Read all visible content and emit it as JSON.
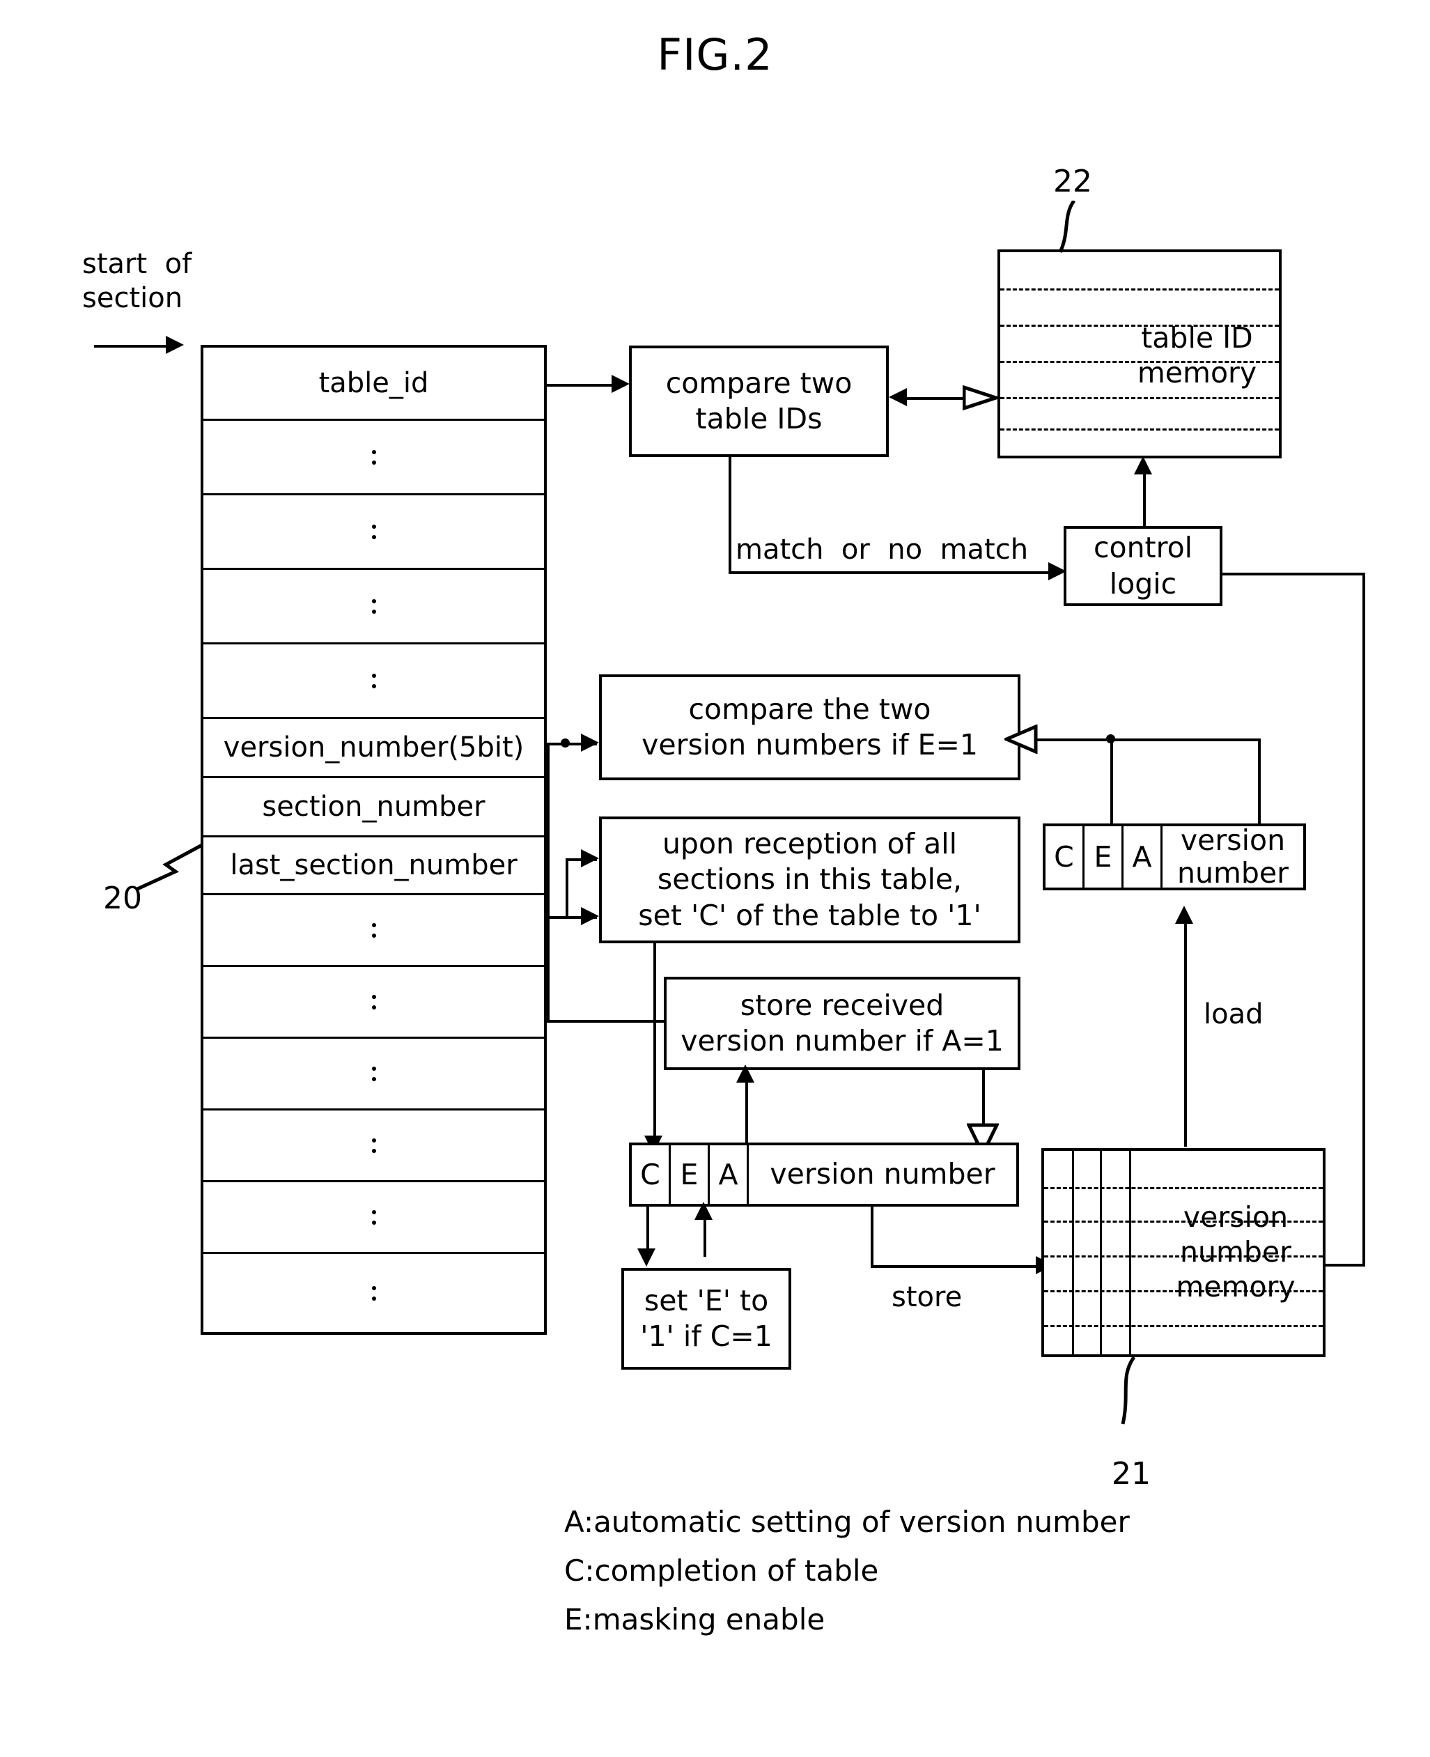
{
  "figure": {
    "title": "FIG.2"
  },
  "input": {
    "start_label": "start  of\nsection"
  },
  "section_table": {
    "ref": "20",
    "rows": [
      {
        "label": "table_id",
        "type": "text"
      },
      {
        "label": "",
        "type": "dots"
      },
      {
        "label": "",
        "type": "dots"
      },
      {
        "label": "",
        "type": "dots"
      },
      {
        "label": "",
        "type": "dots"
      },
      {
        "label": "version_number(5bit)",
        "type": "text"
      },
      {
        "label": "section_number",
        "type": "text"
      },
      {
        "label": "last_section_number",
        "type": "text"
      },
      {
        "label": "",
        "type": "dots"
      },
      {
        "label": "",
        "type": "dots"
      },
      {
        "label": "",
        "type": "dots"
      },
      {
        "label": "",
        "type": "dots"
      },
      {
        "label": "",
        "type": "dots"
      },
      {
        "label": "",
        "type": "dots"
      }
    ]
  },
  "blocks": {
    "compare_table_ids": "compare two\ntable IDs",
    "table_id_memory": "table ID\nmemory",
    "table_id_memory_ref": "22",
    "control_logic": "control\nlogic",
    "match_label": "match  or  no  match",
    "compare_versions": "compare the two\nversion numbers if E=1",
    "upon_reception": "upon reception of all\nsections in this table,\nset 'C' of the table to '1'",
    "store_received": "store received\nversion number if A=1",
    "set_e": "set 'E' to\n'1' if C=1",
    "version_number_memory": "version\nnumber\nmemory",
    "version_number_memory_ref": "21",
    "load_label": "load",
    "store_label": "store"
  },
  "registers": {
    "upper": {
      "c": "C",
      "e": "E",
      "a": "A",
      "value": "version\nnumber"
    },
    "lower": {
      "c": "C",
      "e": "E",
      "a": "A",
      "value": "version  number"
    }
  },
  "legend": {
    "a": "A:automatic  setting  of  version  number",
    "c": "C:completion  of  table",
    "e": "E:masking  enable"
  }
}
